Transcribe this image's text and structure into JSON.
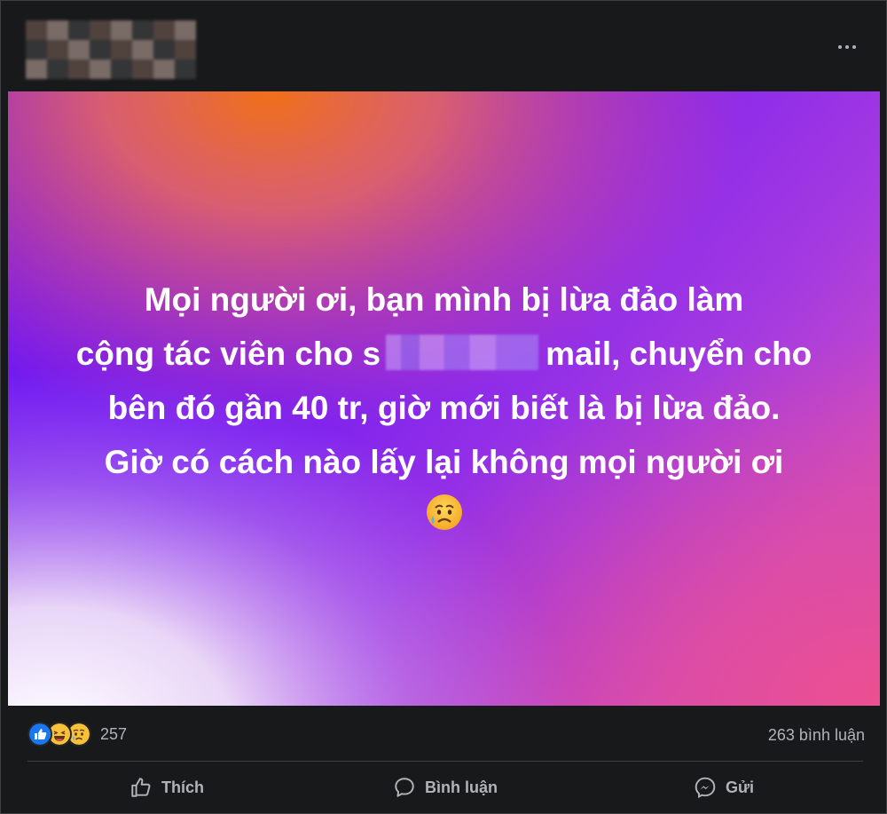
{
  "post": {
    "more_options_icon": "more-horizontal-icon",
    "text_lines": [
      "Mọi người ơi, bạn mình bị lừa đảo làm",
      "mail, chuyển cho",
      "bên đó gần 40 tr, giờ mới biết là bị lừa đảo.",
      "Giờ có cách nào lấy lại không mọi người ơi"
    ],
    "line2_prefix": "cộng tác viên cho s",
    "emoji": "sad-tear-emoji",
    "background_colors": [
      "#6a1cf0",
      "#f06a1c",
      "#e84a8a",
      "#ffffff"
    ]
  },
  "stats": {
    "reactions": [
      "like",
      "haha",
      "sad"
    ],
    "reaction_count": "257",
    "comment_count": "263 bình luận"
  },
  "actions": {
    "like_label": "Thích",
    "comment_label": "Bình luận",
    "share_label": "Gửi"
  }
}
